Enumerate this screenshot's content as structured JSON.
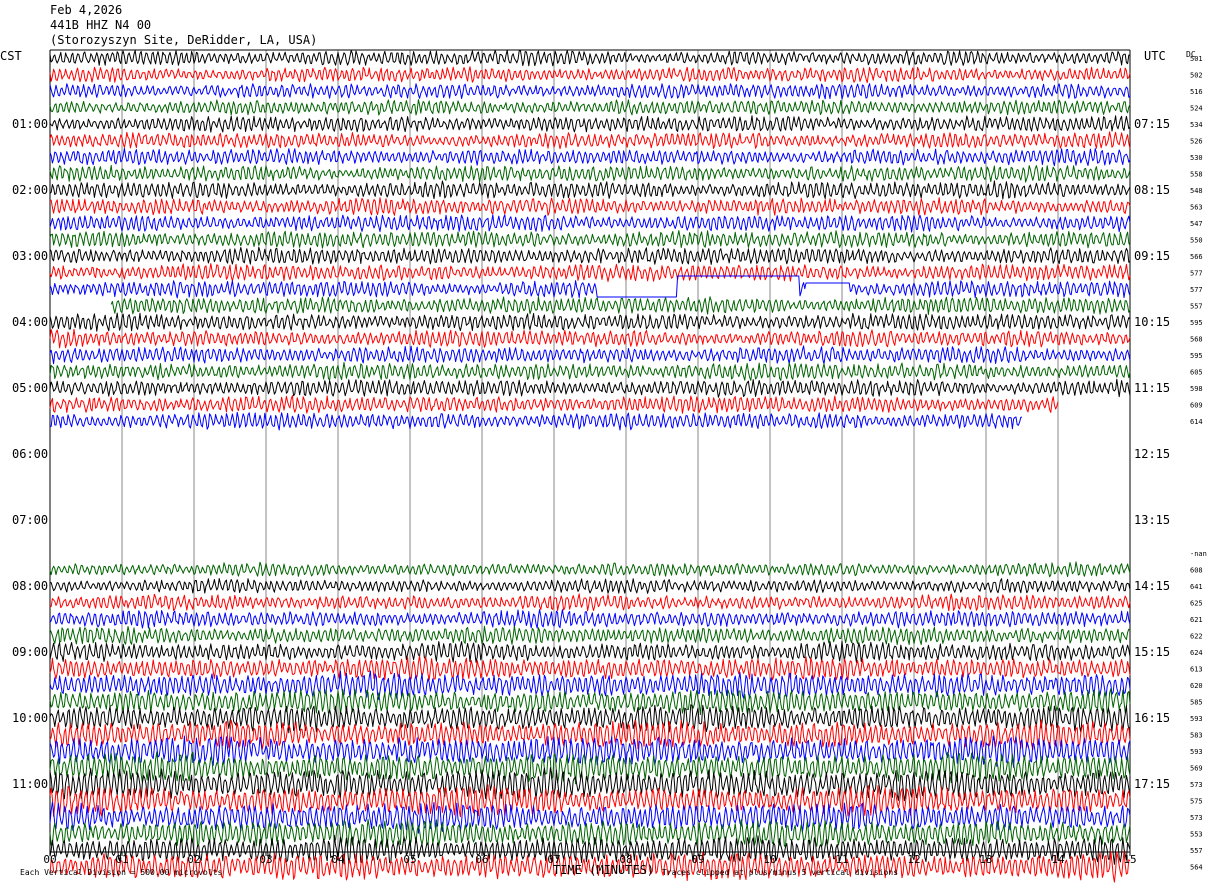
{
  "header": {
    "date": "Feb 4,2026",
    "station": "441B HHZ N4 00",
    "site": "(Storozyszyn Site, DeRidder, LA, USA)"
  },
  "left_tz": "CST",
  "right_tz": "UTC",
  "dc_label": "DC",
  "footer": {
    "left_note": "Each Vertical Division =  500.00 microvolts",
    "xlabel": "TIME (MINUTES)",
    "right_note": "Traces clipped at plus/minus 5 vertical divisions"
  },
  "colors": [
    "#000000",
    "#ff0000",
    "#0000ff",
    "#006400"
  ],
  "chart_data": {
    "type": "line",
    "title": "441B HHZ N4 00",
    "xlabel": "TIME (MINUTES)",
    "xlim": [
      0,
      15
    ],
    "x_ticks": [
      "00",
      "01",
      "02",
      "03",
      "04",
      "05",
      "06",
      "07",
      "08",
      "09",
      "10",
      "11",
      "12",
      "13",
      "14",
      "15"
    ],
    "left_time_labels": [
      "01:00",
      "02:00",
      "03:00",
      "04:00",
      "05:00",
      "06:00",
      "07:00",
      "08:00",
      "09:00",
      "10:00",
      "11:00"
    ],
    "right_time_labels": [
      "07:15",
      "08:15",
      "09:15",
      "10:15",
      "11:15",
      "12:15",
      "13:15",
      "14:15",
      "15:15",
      "16:15",
      "17:15"
    ],
    "trace_minutes": 15,
    "rows": [
      {
        "dc": "501",
        "amp": 0.9
      },
      {
        "dc": "502",
        "amp": 0.9
      },
      {
        "dc": "516",
        "amp": 0.9
      },
      {
        "dc": "524",
        "amp": 0.9
      },
      {
        "dc": "534",
        "amp": 0.95
      },
      {
        "dc": "526",
        "amp": 0.95
      },
      {
        "dc": "530",
        "amp": 0.95
      },
      {
        "dc": "558",
        "amp": 0.95
      },
      {
        "dc": "548",
        "amp": 1.0
      },
      {
        "dc": "563",
        "amp": 1.0
      },
      {
        "dc": "547",
        "amp": 1.0
      },
      {
        "dc": "550",
        "amp": 1.0
      },
      {
        "dc": "566",
        "amp": 1.0
      },
      {
        "dc": "577",
        "amp": 1.0
      },
      {
        "dc": "577",
        "amp": 1.0,
        "gaps": [
          [
            7.6,
            8.7
          ],
          [
            8.7,
            10.4
          ],
          [
            10.5,
            11.1
          ]
        ]
      },
      {
        "dc": "557",
        "amp": 1.0,
        "start": 0.85
      },
      {
        "dc": "595",
        "amp": 1.0
      },
      {
        "dc": "568",
        "amp": 1.0
      },
      {
        "dc": "595",
        "amp": 1.0
      },
      {
        "dc": "605",
        "amp": 1.0
      },
      {
        "dc": "598",
        "amp": 1.0
      },
      {
        "dc": "609",
        "amp": 1.0,
        "end": 14.0
      },
      {
        "dc": "614",
        "amp": 1.0,
        "end": 13.5
      },
      null,
      null,
      null,
      null,
      null,
      null,
      null,
      {
        "dc": "-nan",
        "amp": 0.0
      },
      {
        "dc": "608",
        "amp": 0.8
      },
      {
        "dc": "641",
        "amp": 0.8
      },
      {
        "dc": "625",
        "amp": 0.9
      },
      {
        "dc": "621",
        "amp": 1.0
      },
      {
        "dc": "622",
        "amp": 1.0
      },
      {
        "dc": "624",
        "amp": 1.1
      },
      {
        "dc": "613",
        "amp": 1.3
      },
      {
        "dc": "620",
        "amp": 1.5
      },
      {
        "dc": "585",
        "amp": 1.4
      },
      {
        "dc": "593",
        "amp": 1.5
      },
      {
        "dc": "583",
        "amp": 1.6
      },
      {
        "dc": "593",
        "amp": 1.7
      },
      {
        "dc": "569",
        "amp": 1.7
      },
      {
        "dc": "573",
        "amp": 1.8
      },
      {
        "dc": "575",
        "amp": 1.7
      },
      {
        "dc": "573",
        "amp": 1.7
      },
      {
        "dc": "553",
        "amp": 1.6
      },
      {
        "dc": "557",
        "amp": 1.6
      },
      {
        "dc": "564",
        "amp": 1.6
      }
    ]
  }
}
